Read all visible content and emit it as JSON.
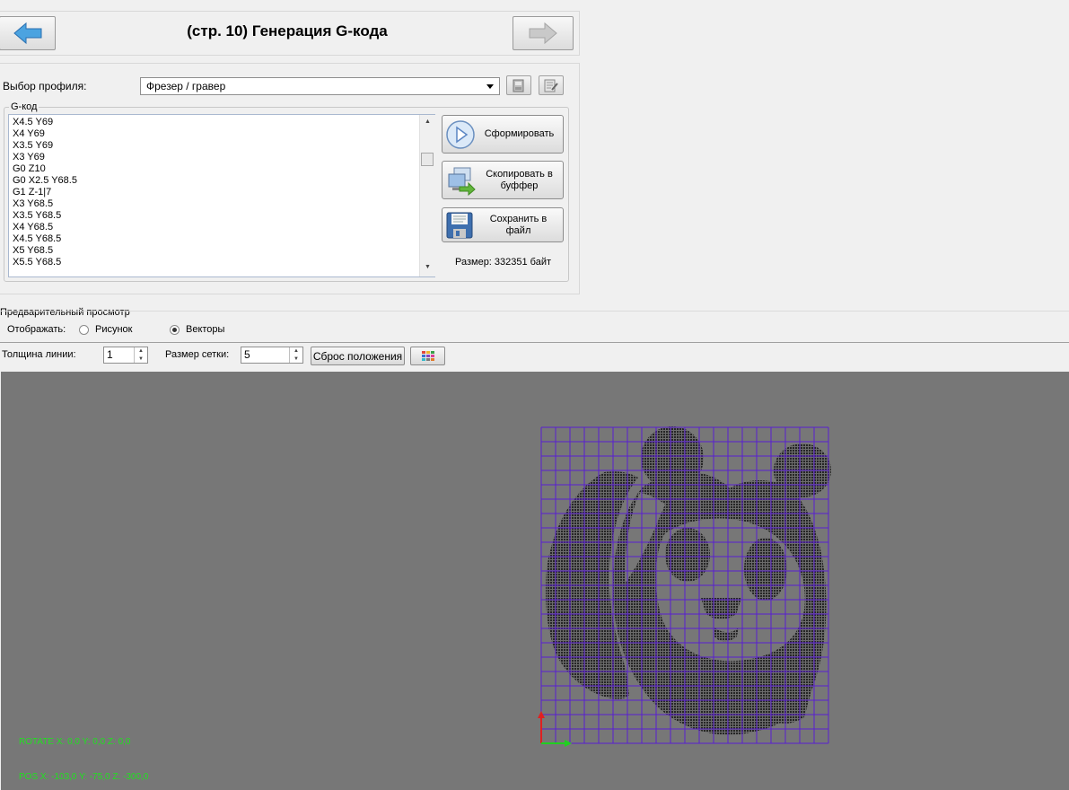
{
  "header": {
    "title": "(стр. 10) Генерация G-кода",
    "back_icon": "arrow-left-icon",
    "forward_icon": "arrow-right-icon"
  },
  "profile": {
    "label": "Выбор профиля:",
    "selected": "Фрезер / гравер"
  },
  "gcode": {
    "group_label": "G-код",
    "lines": [
      "X4.5  Y69",
      "X4  Y69",
      "X3.5  Y69",
      "X3  Y69",
      "G0 Z10",
      "G0 X2.5  Y68.5",
      "G1 Z-1|7",
      "X3  Y68.5",
      "X3.5  Y68.5",
      "X4  Y68.5",
      "X4.5  Y68.5",
      "X5  Y68.5",
      "X5.5  Y68.5"
    ]
  },
  "actions": {
    "generate": "Сформировать",
    "copy_line1": "Скопировать в",
    "copy_line2": "буффер",
    "save_line1": "Сохранить в",
    "save_line2": "файл",
    "size_text": "Размер: 332351 байт"
  },
  "preview": {
    "group_label": "Предварительный просмотр",
    "display_label": "Отображать:",
    "radio_picture": "Рисунок",
    "radio_vectors": "Векторы",
    "selected": "Векторы",
    "line_width_label": "Толщина линии:",
    "line_width_value": "1",
    "grid_size_label": "Размер сетки:",
    "grid_size_value": "5",
    "reset_button": "Сброс положения",
    "palette_icon": "color-palette-icon"
  },
  "viewport": {
    "background": "#777777",
    "grid_color": "#5a1fd0",
    "image_color": "#2e2e2e",
    "rotate_text": "ROTATE X: 0,0  Y: 0,0 Z: 0,0",
    "pos_text": "POS X: -103,0  Y: -75,0 Z: -300,0"
  }
}
